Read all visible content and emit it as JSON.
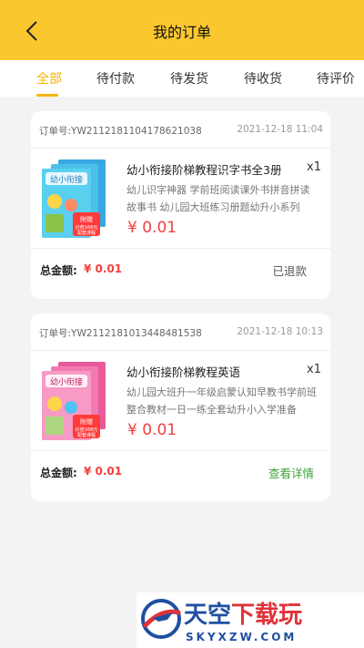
{
  "header": {
    "title": "我的订单"
  },
  "tabs": [
    {
      "label": "全部",
      "active": true
    },
    {
      "label": "待付款"
    },
    {
      "label": "待发货"
    },
    {
      "label": "待收货"
    },
    {
      "label": "待评价"
    }
  ],
  "orders": [
    {
      "order_no": "订单号:YW2112181104178621038",
      "date": "2021-12-18 11:04",
      "title": "幼小衔接阶梯教程识字书全3册",
      "qty": "x1",
      "desc": "幼儿识字神器 学前班阅读课外书拼音拼读故事书 幼儿园大班练习册题幼升小系列",
      "price": "¥ 0.01",
      "total_label": "总金额:",
      "total_value": "¥ 0.01",
      "status": "已退款"
    },
    {
      "order_no": "订单号:YW2112181013448481538",
      "date": "2021-12-18 10:13",
      "title": "幼小衔接阶梯教程英语",
      "qty": "x1",
      "desc": "幼儿园大班升一年级启蒙认知早教书学前班整合教材一日一练全套幼升小入学准备",
      "price": "¥ 0.01",
      "total_label": "总金额:",
      "total_value": "¥ 0.01",
      "status": "查看详情"
    }
  ],
  "thumb": {
    "title_text": "幼小衔接",
    "badge_top": "附赠",
    "badge_mid": "价值168元",
    "badge_bottom": "配套课程"
  },
  "watermark": {
    "main_a": "天空",
    "main_b": "下载玩",
    "sub": "SKYXZW.COM"
  },
  "colors": {
    "accent": "#fbc72e",
    "active_tab": "#f6b300",
    "price": "#f24040",
    "link": "#3da33d"
  }
}
